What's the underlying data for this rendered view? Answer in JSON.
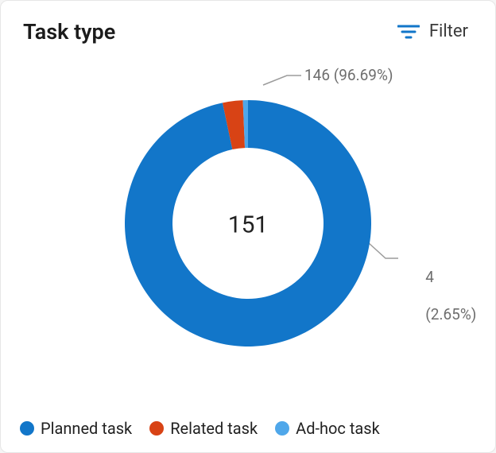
{
  "header": {
    "title": "Task type",
    "filter_label": "Filter"
  },
  "chart_data": {
    "type": "pie",
    "title": "Task type",
    "total": 151,
    "series": [
      {
        "name": "Planned task",
        "value": 146,
        "percent": 96.69,
        "color": "#1276c9"
      },
      {
        "name": "Related task",
        "value": 4,
        "percent": 2.65,
        "color": "#d84315"
      },
      {
        "name": "Ad-hoc task",
        "value": 1,
        "percent": 0.66,
        "color": "#4fa7ea"
      }
    ],
    "legend_position": "bottom",
    "callouts": [
      {
        "text": "146 (96.69%)",
        "series_index": 0
      },
      {
        "text": "4\n(2.65%)",
        "series_index": 1
      }
    ]
  },
  "labels": {
    "center_value": "151",
    "callout_top": "146 (96.69%)",
    "callout_right_line1": "4",
    "callout_right_line2": "(2.65%)",
    "legend_planned": "Planned task",
    "legend_related": "Related task",
    "legend_adhoc": "Ad-hoc task"
  },
  "colors": {
    "planned": "#1276c9",
    "related": "#d84315",
    "adhoc": "#4fa7ea",
    "callout": "#6e6e6e",
    "filter_icon": "#1276c9"
  }
}
